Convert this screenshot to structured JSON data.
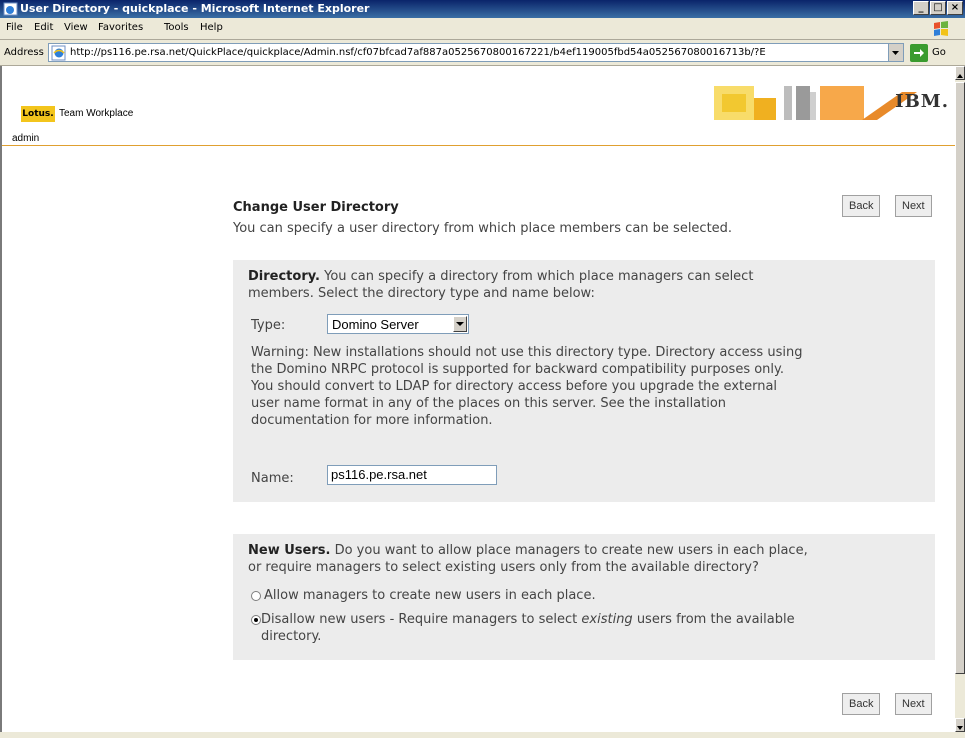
{
  "window": {
    "title": "User Directory - quickplace - Microsoft Internet Explorer",
    "minimize": "_",
    "maximize": "□",
    "close": "×"
  },
  "menubar": {
    "items": [
      "File",
      "Edit",
      "View",
      "Favorites",
      "Tools",
      "Help"
    ]
  },
  "addressbar": {
    "label": "Address",
    "url": "http://ps116.pe.rsa.net/QuickPlace/quickplace/Admin.nsf/cf07bfcad7af887a0525670800167221/b4ef119005fbd54a052567080016713b/?E",
    "go_label": "Go"
  },
  "header": {
    "brand": "Lotus.",
    "product": "Team Workplace",
    "vendor": "IBM.",
    "user_link": "admin"
  },
  "content": {
    "title": "Change User Directory",
    "description": "You can specify a user directory from which place members can be selected.",
    "back_label": "Back",
    "next_label": "Next",
    "directory": {
      "heading": "Directory.",
      "intro_line1": "You can specify a directory from which place managers can select",
      "intro_line2": "members. Select the directory type and name below:",
      "type_label": "Type:",
      "type_value": "Domino Server",
      "warning_lines": [
        "Warning: New installations should not use this directory type. Directory access using",
        "the Domino NRPC protocol is supported for backward compatibility purposes only.",
        "You should convert to LDAP for directory access before you upgrade the external",
        "user name format in any of the places on this server. See the installation",
        "documentation for more information."
      ],
      "name_label": "Name:",
      "name_value": "ps116.pe.rsa.net"
    },
    "new_users": {
      "heading": "New Users.",
      "intro_line1": "Do you want to allow place managers to create new users in each place,",
      "intro_line2": "or require managers to select existing users only from the available directory?",
      "option_allow": "Allow managers to create new users in each place.",
      "option_disallow_pre": "Disallow new users - Require managers to select ",
      "option_disallow_em": "existing",
      "option_disallow_post": " users from the available",
      "option_disallow_line2": "directory.",
      "selected": "disallow"
    }
  },
  "colors": {
    "titlebar": "#0a246a",
    "header_rule": "#e0a030",
    "lotus_yellow": "#f3c51c",
    "panel_bg": "#ececec"
  }
}
